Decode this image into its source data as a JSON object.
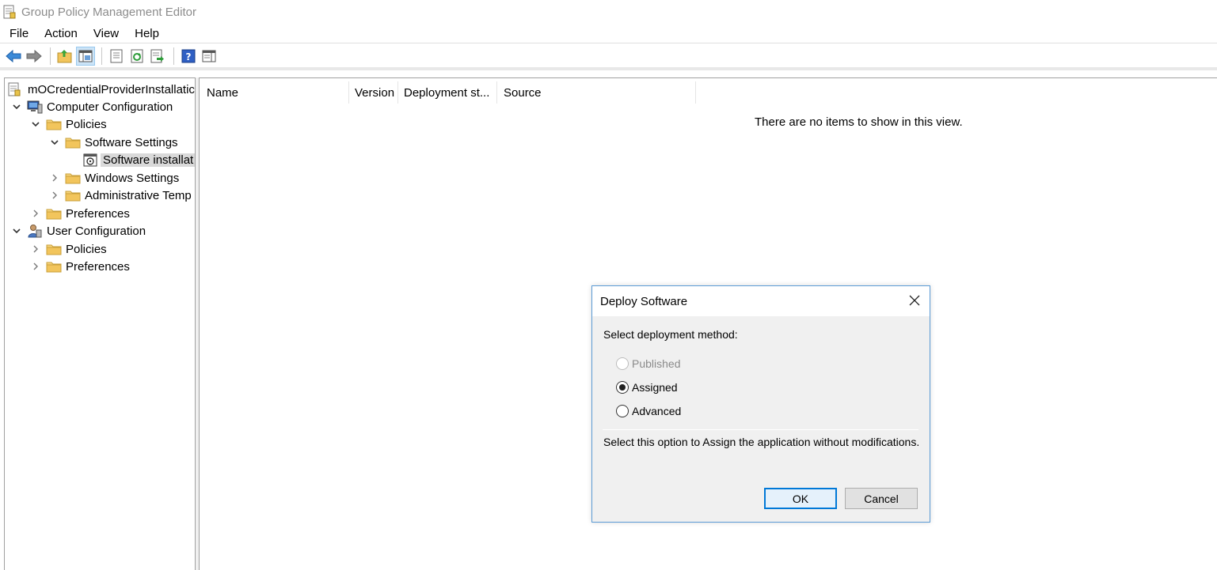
{
  "window": {
    "title": "Group Policy Management Editor"
  },
  "menu": [
    "File",
    "Action",
    "View",
    "Help"
  ],
  "toolbar": {
    "buttons": [
      "back-arrow-icon",
      "forward-arrow-icon",
      "up-folder-icon",
      "show-hide-tree-icon",
      "properties-icon",
      "refresh-icon",
      "export-list-icon",
      "help-icon",
      "show-action-pane-icon"
    ]
  },
  "tree": {
    "items": [
      {
        "label": "mOCredentialProviderInstallatic",
        "icon": "policy-document-icon",
        "level": 0,
        "chevron": "none"
      },
      {
        "label": "Computer Configuration",
        "icon": "computer-icon",
        "level": 0,
        "chevron": "expanded"
      },
      {
        "label": "Policies",
        "icon": "folder-icon",
        "level": 1,
        "chevron": "expanded"
      },
      {
        "label": "Software Settings",
        "icon": "folder-icon",
        "level": 2,
        "chevron": "expanded"
      },
      {
        "label": "Software installat",
        "icon": "software-installation-icon",
        "level": 3,
        "chevron": "none",
        "selected": true
      },
      {
        "label": "Windows Settings",
        "icon": "folder-icon",
        "level": 2,
        "chevron": "collapsed"
      },
      {
        "label": "Administrative Temp",
        "icon": "folder-icon",
        "level": 2,
        "chevron": "collapsed"
      },
      {
        "label": "Preferences",
        "icon": "folder-icon",
        "level": 1,
        "chevron": "collapsed"
      },
      {
        "label": "User Configuration",
        "icon": "user-icon",
        "level": 0,
        "chevron": "expanded"
      },
      {
        "label": "Policies",
        "icon": "folder-icon",
        "level": 1,
        "chevron": "collapsed"
      },
      {
        "label": "Preferences",
        "icon": "folder-icon",
        "level": 1,
        "chevron": "collapsed"
      }
    ]
  },
  "list": {
    "columns": [
      "Name",
      "Version",
      "Deployment st...",
      "Source"
    ],
    "empty_message": "There are no items to show in this view."
  },
  "dialog": {
    "title": "Deploy Software",
    "prompt": "Select deployment method:",
    "options": [
      {
        "label": "Published",
        "checked": false,
        "disabled": true
      },
      {
        "label": "Assigned",
        "checked": true,
        "disabled": false
      },
      {
        "label": "Advanced",
        "checked": false,
        "disabled": false
      }
    ],
    "description": "Select this option to Assign the application without modifications.",
    "ok_label": "OK",
    "cancel_label": "Cancel"
  },
  "colors": {
    "accent": "#0078d7",
    "folder": "#f2c55c",
    "selection": "#d9d9d9",
    "dialog_border": "#5b9bd5"
  }
}
